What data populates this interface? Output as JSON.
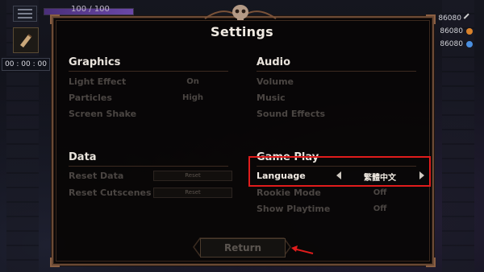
{
  "hud": {
    "hp_text": "100 / 100",
    "hp_fraction": 1.0,
    "timer": "00 : 00 : 00",
    "resources": [
      {
        "value": "86080",
        "icon": "crossed-swords-icon",
        "color": "#cfcfcf"
      },
      {
        "value": "86080",
        "icon": "orange-orb-icon",
        "color": "#d9822b"
      },
      {
        "value": "86080",
        "icon": "blue-orb-icon",
        "color": "#4a8fe0"
      }
    ]
  },
  "dialog": {
    "title": "Settings",
    "graphics": {
      "header": "Graphics",
      "rows": [
        {
          "label": "Light Effect",
          "value": "On"
        },
        {
          "label": "Particles",
          "value": "High"
        },
        {
          "label": "Screen Shake",
          "value": ""
        }
      ]
    },
    "audio": {
      "header": "Audio",
      "rows": [
        {
          "label": "Volume"
        },
        {
          "label": "Music"
        },
        {
          "label": "Sound Effects"
        }
      ]
    },
    "data": {
      "header": "Data",
      "rows": [
        {
          "label": "Reset Data",
          "button": "Reset"
        },
        {
          "label": "Reset Cutscenes",
          "button": "Reset"
        }
      ]
    },
    "gameplay": {
      "header": "Game Play",
      "rows": [
        {
          "label": "Language",
          "value": "繁體中文"
        },
        {
          "label": "Rookie Mode",
          "value": "Off"
        },
        {
          "label": "Show Playtime",
          "value": "Off"
        }
      ]
    },
    "return_label": "Return"
  },
  "colors": {
    "highlight": "#e01c1c",
    "frame": "#6b4a35",
    "hp_bar": "#6a48a8"
  }
}
